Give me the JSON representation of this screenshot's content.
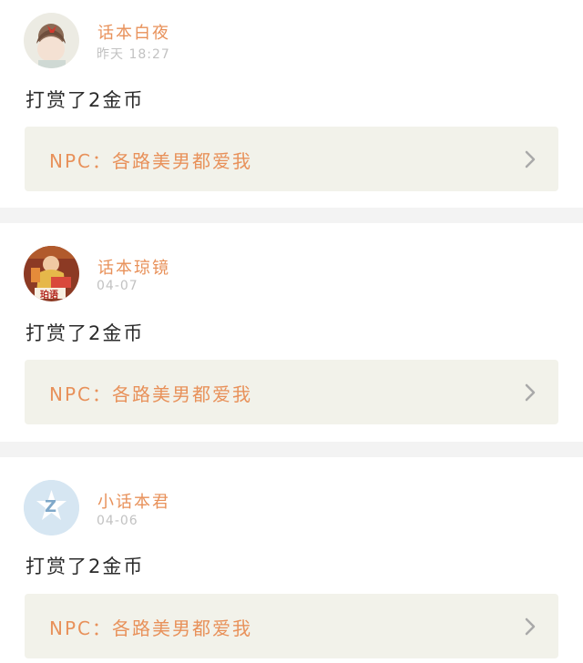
{
  "feed": {
    "items": [
      {
        "user_name": "话本白夜",
        "time": "昨天 18:27",
        "reward": "打赏了2金币",
        "work_title": "NPC：各路美男都爱我"
      },
      {
        "user_name": "话本琼镜",
        "time": "04-07",
        "reward": "打赏了2金币",
        "work_title": "NPC：各路美男都爱我",
        "avatar_badge": "珀语"
      },
      {
        "user_name": "小话本君",
        "time": "04-06",
        "reward": "打赏了2金币",
        "work_title": "NPC：各路美男都爱我",
        "avatar_letter": "Z"
      }
    ]
  },
  "colors": {
    "accent": "#e8915a",
    "link_bg": "#f2f2ea",
    "page_bg": "#f3f3f3",
    "time_text": "#c2c2c2"
  }
}
